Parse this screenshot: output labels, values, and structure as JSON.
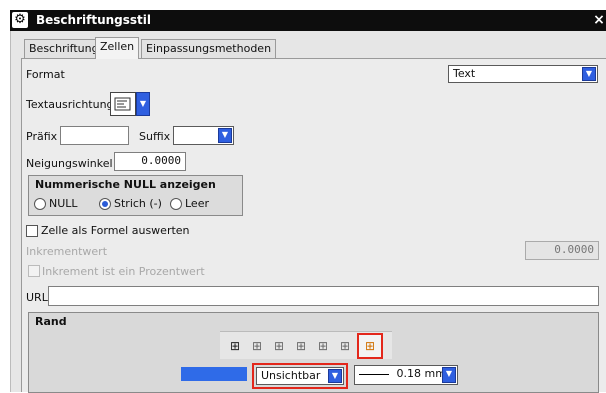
{
  "window": {
    "title": "Beschriftungsstil",
    "close_glyph": "×",
    "gear_glyph": "⚙"
  },
  "tabs": [
    {
      "label": "Beschriftung"
    },
    {
      "label": "Zellen"
    },
    {
      "label": "Einpassungsmethoden"
    }
  ],
  "format": {
    "label": "Format",
    "value": "Text"
  },
  "textausrichtung": {
    "label": "Textausrichtung",
    "icon": "align-left-icon"
  },
  "praefix": {
    "label": "Präfix",
    "value": ""
  },
  "suffix": {
    "label": "Suffix",
    "value": ""
  },
  "neigungswinkel": {
    "label": "Neigungswinkel",
    "value": "0.0000"
  },
  "null_group": {
    "title": "Nummerische NULL anzeigen",
    "options": [
      {
        "label": "NULL",
        "selected": false
      },
      {
        "label": "Strich (-)",
        "selected": true
      },
      {
        "label": "Leer",
        "selected": false
      }
    ]
  },
  "formel": {
    "label": "Zelle als Formel auswerten",
    "checked": false
  },
  "inkrement": {
    "label": "Inkrementwert",
    "value": "0.0000"
  },
  "inkrement_prozent": {
    "label": "Inkrement ist ein Prozentwert",
    "checked": false
  },
  "url": {
    "label": "URL",
    "value": ""
  },
  "rand": {
    "title": "Rand",
    "style_value": "Unsichtbar",
    "weight_value": "0.18 mm",
    "line_color": "#2f6be8"
  },
  "colors": {
    "accent": "#2f5fe0",
    "highlight": "#e3271b",
    "titlebar": "#0d0d0d"
  }
}
